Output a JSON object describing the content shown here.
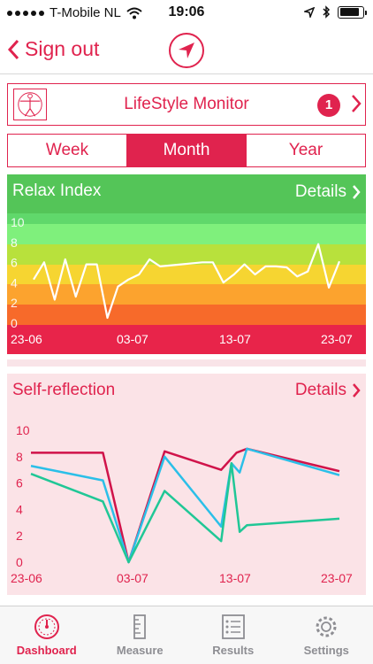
{
  "status": {
    "carrier": "T-Mobile NL",
    "time": "19:06",
    "battery_level": 0.85
  },
  "nav": {
    "signout_label": "Sign out",
    "location_icon": "location-arrow-icon"
  },
  "monitor": {
    "title": "LifeStyle Monitor",
    "badge": "1",
    "logo_icon": "vitruvian-man-icon"
  },
  "segments": [
    {
      "label": "Week",
      "active": false
    },
    {
      "label": "Month",
      "active": true
    },
    {
      "label": "Year",
      "active": false
    }
  ],
  "relax_panel": {
    "title": "Relax Index",
    "details_label": "Details",
    "band_colors": [
      "#e8244a",
      "#f76a2a",
      "#fca32e",
      "#f6d531",
      "#b8e13c",
      "#7ff07c",
      "#60d86b",
      "#54c558"
    ]
  },
  "self_panel": {
    "title": "Self-reflection",
    "details_label": "Details"
  },
  "chart_data": [
    {
      "type": "line",
      "title": "Relax Index",
      "x_tick_labels": [
        "23-06",
        "03-07",
        "13-07",
        "23-07"
      ],
      "y_tick_labels": [
        "0",
        "2",
        "4",
        "6",
        "8",
        "10"
      ],
      "ylim": [
        0,
        10
      ],
      "series": [
        {
          "color": "#ffffff",
          "values": [
            4.5,
            6.2,
            2.5,
            6.5,
            2.8,
            6.0,
            6.0,
            0.7,
            3.8,
            4.5,
            5.0,
            6.5,
            5.8,
            5.9,
            6.0,
            6.1,
            6.2,
            6.2,
            4.2,
            5.0,
            6.0,
            5.0,
            5.8,
            5.8,
            5.7,
            4.8,
            5.3,
            8.0,
            3.7,
            6.3
          ]
        }
      ]
    },
    {
      "type": "line",
      "title": "Self-reflection",
      "x_tick_labels": [
        "23-06",
        "03-07",
        "13-07",
        "23-07"
      ],
      "y_tick_labels": [
        "0",
        "2",
        "4",
        "6",
        "8",
        "10"
      ],
      "ylim": [
        0,
        10
      ],
      "series": [
        {
          "color": "#d0134a",
          "points": [
            [
              0,
              8.3
            ],
            [
              7,
              8.3
            ],
            [
              9.5,
              0
            ],
            [
              13,
              8.4
            ],
            [
              18.5,
              7.0
            ],
            [
              20,
              8.3
            ],
            [
              21,
              8.6
            ],
            [
              30,
              6.9
            ]
          ]
        },
        {
          "color": "#2bbfe8",
          "points": [
            [
              0,
              7.3
            ],
            [
              7,
              6.2
            ],
            [
              9.5,
              0
            ],
            [
              13,
              8.0
            ],
            [
              18.5,
              2.7
            ],
            [
              19.5,
              7.5
            ],
            [
              20.3,
              6.8
            ],
            [
              21,
              8.6
            ],
            [
              30,
              6.6
            ]
          ]
        },
        {
          "color": "#20c796",
          "points": [
            [
              0,
              6.7
            ],
            [
              7,
              4.6
            ],
            [
              9.5,
              0
            ],
            [
              13,
              5.4
            ],
            [
              18.5,
              1.6
            ],
            [
              19.5,
              7.5
            ],
            [
              20.3,
              2.3
            ],
            [
              21,
              2.8
            ],
            [
              30,
              3.3
            ]
          ]
        }
      ]
    }
  ],
  "tabs": [
    {
      "label": "Dashboard",
      "icon": "speedometer-icon",
      "active": true
    },
    {
      "label": "Measure",
      "icon": "ruler-icon",
      "active": false
    },
    {
      "label": "Results",
      "icon": "list-icon",
      "active": false
    },
    {
      "label": "Settings",
      "icon": "gear-icon",
      "active": false
    }
  ]
}
